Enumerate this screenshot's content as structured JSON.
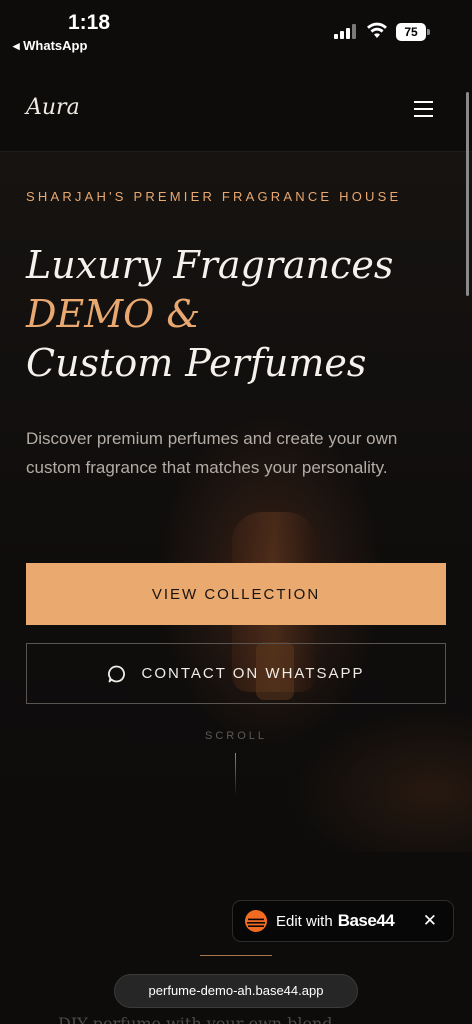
{
  "status_bar": {
    "time": "1:18",
    "back_app": "◂ WhatsApp",
    "battery": "75"
  },
  "nav": {
    "logo": "Aura",
    "menu_icon": "hamburger-menu-icon"
  },
  "hero": {
    "eyebrow": "SHARJAH'S PREMIER FRAGRANCE HOUSE",
    "headline_line1": "Luxury Fragrances",
    "headline_accent": "DEMO &",
    "headline_line3": "Custom Perfumes",
    "description": "Discover premium perfumes and create your own custom fragrance that matches your personality.",
    "primary_button": "VIEW COLLECTION",
    "secondary_button": "CONTACT ON WHATSAPP",
    "secondary_icon": "chat-bubble-icon",
    "scroll_label": "SCROLL"
  },
  "badge": {
    "edit_text": "Edit with",
    "brand": "Base44",
    "close": "✕"
  },
  "browser": {
    "url": "perfume-demo-ah.base44.app"
  },
  "next_section_peek": "DIY perfume with your own blend",
  "colors": {
    "accent": "#e9a96f",
    "background": "#0d0c0b",
    "muted_text": "#b3aca4"
  }
}
